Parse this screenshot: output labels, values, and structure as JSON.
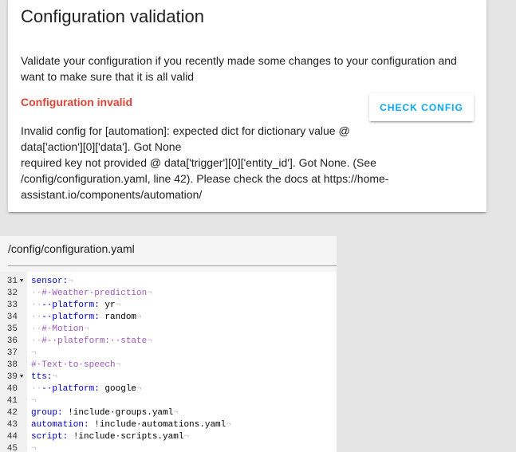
{
  "card": {
    "title": "Configuration validation",
    "description": "Validate your configuration if you recently made some changes to your configuration and want to make sure that it is all valid",
    "status": "Configuration invalid",
    "check_button": "CHECK CONFIG",
    "errors": [
      "Invalid config for [automation]: expected dict for dictionary value @ data['action'][0]['data']. Got None",
      "required key not provided @ data['trigger'][0]['entity_id']. Got None. (See /config/configuration.yaml, line 42). Please check the docs at https://home-assistant.io/components/automation/"
    ]
  },
  "editor": {
    "file_path": "/config/configuration.yaml",
    "lines": [
      {
        "n": "31",
        "fold": true,
        "parts": [
          [
            "k",
            "sensor:"
          ],
          [
            "ws",
            "¬"
          ]
        ]
      },
      {
        "n": "32",
        "fold": false,
        "parts": [
          [
            "ws",
            "··"
          ],
          [
            "c",
            "#·Weather·prediction"
          ],
          [
            "ws",
            "¬"
          ]
        ]
      },
      {
        "n": "33",
        "fold": false,
        "parts": [
          [
            "ws",
            "··"
          ],
          [
            "k",
            "-·platform:"
          ],
          [
            "v",
            " yr"
          ],
          [
            "ws",
            "¬"
          ]
        ]
      },
      {
        "n": "34",
        "fold": false,
        "parts": [
          [
            "ws",
            "··"
          ],
          [
            "k",
            "-·platform:"
          ],
          [
            "v",
            " random"
          ],
          [
            "ws",
            "¬"
          ]
        ]
      },
      {
        "n": "35",
        "fold": false,
        "parts": [
          [
            "ws",
            "··"
          ],
          [
            "c",
            "#·Motion"
          ],
          [
            "ws",
            "¬"
          ]
        ]
      },
      {
        "n": "36",
        "fold": false,
        "parts": [
          [
            "ws",
            "··"
          ],
          [
            "c",
            "#-·plateform:··state"
          ],
          [
            "ws",
            "¬"
          ]
        ]
      },
      {
        "n": "37",
        "fold": false,
        "parts": [
          [
            "ws",
            "¬"
          ]
        ]
      },
      {
        "n": "38",
        "fold": false,
        "parts": [
          [
            "c",
            "#·Text·to·speech"
          ],
          [
            "ws",
            "¬"
          ]
        ]
      },
      {
        "n": "39",
        "fold": true,
        "parts": [
          [
            "k",
            "tts:"
          ],
          [
            "ws",
            "¬"
          ]
        ]
      },
      {
        "n": "40",
        "fold": false,
        "parts": [
          [
            "ws",
            "··"
          ],
          [
            "k",
            "-·platform:"
          ],
          [
            "v",
            " google"
          ],
          [
            "ws",
            "¬"
          ]
        ]
      },
      {
        "n": "41",
        "fold": false,
        "parts": [
          [
            "ws",
            "¬"
          ]
        ]
      },
      {
        "n": "42",
        "fold": false,
        "parts": [
          [
            "k",
            "group:"
          ],
          [
            "v",
            " !include·groups.yaml"
          ],
          [
            "ws",
            "¬"
          ]
        ]
      },
      {
        "n": "43",
        "fold": false,
        "parts": [
          [
            "k",
            "automation:"
          ],
          [
            "v",
            " !include·automations.yaml"
          ],
          [
            "ws",
            "¬"
          ]
        ]
      },
      {
        "n": "44",
        "fold": false,
        "parts": [
          [
            "k",
            "script:"
          ],
          [
            "v",
            " !include·scripts.yaml"
          ],
          [
            "ws",
            "¬"
          ]
        ]
      },
      {
        "n": "45",
        "fold": false,
        "parts": [
          [
            "ws",
            "¬"
          ]
        ]
      }
    ]
  }
}
